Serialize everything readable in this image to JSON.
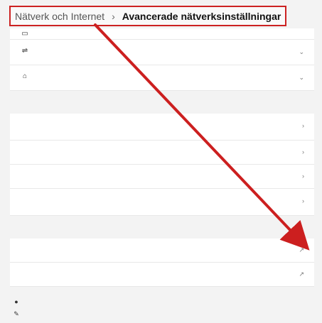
{
  "breadcrumb": {
    "parent": "Nätverk och Internet",
    "separator": "›",
    "current": "Avancerade nätverksinställningar"
  },
  "network_adapters": [
    {
      "icon": "ethernet-icon",
      "name": "",
      "description": "",
      "status": ""
    },
    {
      "icon": "wifi-icon",
      "name": "",
      "description": "",
      "status": ""
    }
  ],
  "sections": {
    "more_settings_title": "",
    "related_settings_title": ""
  },
  "more_settings_items": [
    {
      "title": "",
      "subtitle": ""
    },
    {
      "title": ""
    },
    {
      "title": ""
    },
    {
      "title": "",
      "subtitle": ""
    }
  ],
  "related_settings_items": [
    {
      "title": ""
    },
    {
      "title": ""
    }
  ],
  "footer_links": [
    {
      "icon": "help-icon",
      "label": ""
    },
    {
      "icon": "feedback-icon",
      "label": ""
    }
  ],
  "annotation": {
    "arrow_color": "#cc1f1f",
    "box_color": "#cc2222"
  }
}
